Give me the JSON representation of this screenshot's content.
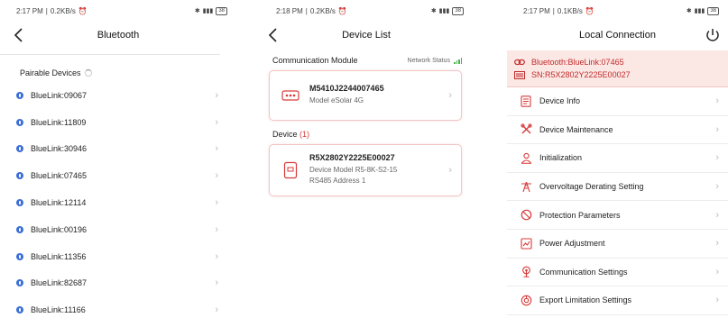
{
  "screen1": {
    "status": {
      "time": "2:17 PM",
      "speed": "0.2KB/s",
      "battery": "38"
    },
    "title": "Bluetooth",
    "section_label": "Pairable Devices",
    "devices": [
      "BlueLink:09067",
      "BlueLink:11809",
      "BlueLink:30946",
      "BlueLink:07465",
      "BlueLink:12114",
      "BlueLink:00196",
      "BlueLink:11356",
      "BlueLink:82687",
      "BlueLink:11166"
    ]
  },
  "screen2": {
    "status": {
      "time": "2:18 PM",
      "speed": "0.2KB/s",
      "battery": "38"
    },
    "title": "Device List",
    "module_header": "Communication Module",
    "network_status": "Network Status",
    "module": {
      "serial": "M5410J2244007465",
      "model": "Model  eSolar 4G"
    },
    "device_label": "Device",
    "device_count": "(1)",
    "device": {
      "serial": "R5X2802Y2225E00027",
      "model": "Device Model  R5-8K-S2-15",
      "address": "RS485 Address  1"
    }
  },
  "screen3": {
    "status": {
      "time": "2:17 PM",
      "speed": "0.1KB/s",
      "battery": "38"
    },
    "title": "Local Connection",
    "bluetooth_line": "Bluetooth:BlueLink:07465",
    "sn_line": "SN:R5X2802Y2225E00027",
    "menu": [
      {
        "label": "Device Info",
        "icon": "document-icon"
      },
      {
        "label": "Device Maintenance",
        "icon": "tools-icon"
      },
      {
        "label": "Initialization",
        "icon": "person-icon"
      },
      {
        "label": "Overvoltage Derating Setting",
        "icon": "tower-icon"
      },
      {
        "label": "Protection Parameters",
        "icon": "shield-icon"
      },
      {
        "label": "Power Adjustment",
        "icon": "chart-icon"
      },
      {
        "label": "Communication Settings",
        "icon": "antenna-icon"
      },
      {
        "label": "Export Limitation Settings",
        "icon": "export-icon"
      }
    ]
  },
  "colors": {
    "accent": "#d93a3a",
    "bluetooth": "#3b6fd8",
    "signal": "#4cb24c",
    "highlight_bg": "#fbe7e4"
  }
}
